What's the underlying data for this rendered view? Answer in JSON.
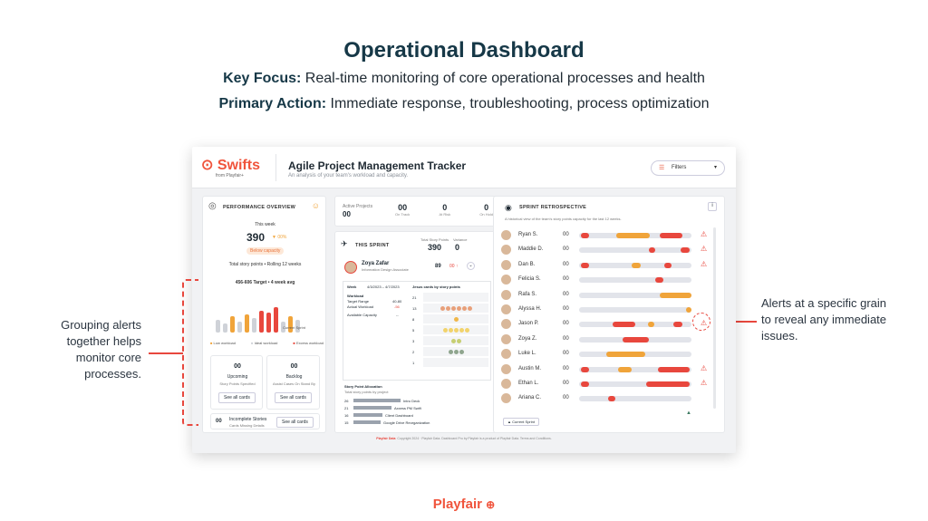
{
  "slide": {
    "title": "Operational Dashboard",
    "key_focus_label": "Key Focus:",
    "key_focus_text": "Real-time monitoring of core operational processes and health",
    "primary_action_label": "Primary Action:",
    "primary_action_text": "Immediate response, troubleshooting, process optimization",
    "annotation_left": "Grouping alerts together helps monitor core processes.",
    "annotation_right": "Alerts at a specific grain to reveal any immediate issues.",
    "footer_brand": "Playfair"
  },
  "dashboard": {
    "logo": "Swifts",
    "logo_sub": "from Playfair+",
    "title": "Agile Project Management Tracker",
    "subtitle": "An analysis of your team's workload and capacity.",
    "filters_label": "Filters",
    "footer_brand": "Playfair Data",
    "footer_text": "Copyright 2024 · Playfair Data. Dashboard Pro by Playfair is a product of Playfair Data. Terms and Conditions."
  },
  "performance": {
    "header": "PERFORMANCE OVERVIEW",
    "this_week_label": "This week",
    "value": "390",
    "delta": "▼ 00%",
    "badge": "Below capacity",
    "story_points_label": "Total story points",
    "rolling_label": "Rolling 12 weeks",
    "target": "456-606 Target",
    "avg": "4 week avg",
    "current_sprint_label": "Current Sprint",
    "legend": [
      "Low workload",
      "Ideal workload",
      "Excess workload"
    ],
    "upcoming_value": "00",
    "upcoming_label": "Upcoming",
    "upcoming_sub": "Story Points Specified",
    "backlog_value": "00",
    "backlog_label": "Backlog",
    "backlog_sub": "Assist Cases On Stand By",
    "see_all_cards": "See all cards",
    "incomplete_value": "00",
    "incomplete_label": "Incomplete Stories",
    "incomplete_sub": "Cards Missing Details"
  },
  "summary": {
    "active_label": "Active Projects",
    "active_value": "00",
    "stats": [
      {
        "value": "00",
        "label": "On Track"
      },
      {
        "value": "0",
        "label": "At Risk"
      },
      {
        "value": "0",
        "label": "On Hold"
      }
    ]
  },
  "sprint": {
    "header": "THIS SPRINT",
    "story_points_label": "Total Story Points",
    "story_points_value": "390",
    "variance_label": "Variance",
    "variance_value": "0",
    "person_name": "Zoya Zafar",
    "person_role": "Information Design Associate",
    "person_points": "89",
    "person_delta": "00 ↑",
    "week_label": "Week",
    "week_range": "4/3/2023 – 4/7/2023",
    "workload_label": "Workload",
    "target_range_label": "Target Range",
    "target_range_value": "40-80",
    "actual_label": "Actual Workload",
    "actual_value": "-56",
    "available_label": "Available Capacity",
    "available_value": "--",
    "grid_title": "Jesus cards by story points",
    "grid_rows": [
      {
        "points": "21",
        "dots": [],
        "color": "#e2e4ea"
      },
      {
        "points": "13",
        "dots": [
          1,
          1,
          1,
          1,
          1,
          1
        ],
        "color": "#e8a07a"
      },
      {
        "points": "8",
        "dots": [
          1
        ],
        "color": "#f0b74a"
      },
      {
        "points": "5",
        "dots": [
          1,
          1,
          1,
          1,
          1
        ],
        "color": "#f2d36b"
      },
      {
        "points": "3",
        "dots": [
          1,
          1
        ],
        "color": "#c7cf72"
      },
      {
        "points": "2",
        "dots": [
          1,
          1,
          1
        ],
        "color": "#8fa58e"
      },
      {
        "points": "1",
        "dots": [],
        "color": "#e2e4ea"
      }
    ],
    "allocation_title": "Story Point Allocation",
    "allocation_sub": "Total story points by project",
    "allocation": [
      {
        "value": "26",
        "label": "Intro Deck"
      },
      {
        "value": "21",
        "label": "Axxess PM Swift"
      },
      {
        "value": "16",
        "label": "Client Dashboard"
      },
      {
        "value": "15",
        "label": "Google Drive Reorganization"
      }
    ]
  },
  "retro": {
    "header": "SPRINT RETROSPECTIVE",
    "subtitle": "A historical view of the team's story points capacity for the last 12 weeks.",
    "current_sprint_label": "Current Sprint",
    "rows": [
      {
        "name": "Ryan S.",
        "value": "00",
        "warn": true,
        "segs": [
          {
            "s": 0.02,
            "w": 0.07,
            "c": "#e8473d"
          },
          {
            "s": 0.33,
            "w": 0.3,
            "c": "#f0a43a"
          },
          {
            "s": 0.72,
            "w": 0.2,
            "c": "#e8473d"
          }
        ]
      },
      {
        "name": "Maddie D.",
        "value": "00",
        "warn": true,
        "segs": [
          {
            "s": 0.62,
            "w": 0.06,
            "c": "#e8473d"
          },
          {
            "s": 0.9,
            "w": 0.08,
            "c": "#e8473d"
          }
        ]
      },
      {
        "name": "Dan B.",
        "value": "00",
        "warn": true,
        "segs": [
          {
            "s": 0.02,
            "w": 0.07,
            "c": "#e8473d"
          },
          {
            "s": 0.47,
            "w": 0.08,
            "c": "#f0a43a"
          },
          {
            "s": 0.76,
            "w": 0.06,
            "c": "#e8473d"
          }
        ]
      },
      {
        "name": "Felicia S.",
        "value": "00",
        "warn": false,
        "segs": [
          {
            "s": 0.68,
            "w": 0.07,
            "c": "#e8473d"
          }
        ]
      },
      {
        "name": "Rafa S.",
        "value": "00",
        "warn": false,
        "segs": [
          {
            "s": 0.72,
            "w": 0.28,
            "c": "#f0a43a"
          }
        ]
      },
      {
        "name": "Alyssa H.",
        "value": "00",
        "warn": false,
        "segs": [
          {
            "s": 0.95,
            "w": 0.05,
            "c": "#f0a43a"
          }
        ]
      },
      {
        "name": "Jason P.",
        "value": "00",
        "warn": true,
        "segs": [
          {
            "s": 0.3,
            "w": 0.2,
            "c": "#e8473d"
          },
          {
            "s": 0.61,
            "w": 0.06,
            "c": "#f0a43a"
          },
          {
            "s": 0.84,
            "w": 0.08,
            "c": "#e8473d"
          }
        ]
      },
      {
        "name": "Zoya Z.",
        "value": "00",
        "warn": false,
        "segs": [
          {
            "s": 0.39,
            "w": 0.23,
            "c": "#e8473d"
          }
        ]
      },
      {
        "name": "Luke L.",
        "value": "00",
        "warn": false,
        "segs": [
          {
            "s": 0.24,
            "w": 0.35,
            "c": "#f0a43a"
          }
        ]
      },
      {
        "name": "Austin M.",
        "value": "00",
        "warn": true,
        "segs": [
          {
            "s": 0.02,
            "w": 0.07,
            "c": "#e8473d"
          },
          {
            "s": 0.35,
            "w": 0.12,
            "c": "#f0a43a"
          },
          {
            "s": 0.7,
            "w": 0.28,
            "c": "#e8473d"
          }
        ]
      },
      {
        "name": "Ethan L.",
        "value": "00",
        "warn": true,
        "segs": [
          {
            "s": 0.02,
            "w": 0.07,
            "c": "#e8473d"
          },
          {
            "s": 0.6,
            "w": 0.38,
            "c": "#e8473d"
          }
        ]
      },
      {
        "name": "Ariana C.",
        "value": "00",
        "warn": false,
        "segs": [
          {
            "s": 0.26,
            "w": 0.06,
            "c": "#e8473d"
          }
        ]
      }
    ]
  },
  "colors": {
    "accent": "#f0543c",
    "alert": "#e8473d",
    "orange": "#f0a43a",
    "navy": "#163847"
  }
}
